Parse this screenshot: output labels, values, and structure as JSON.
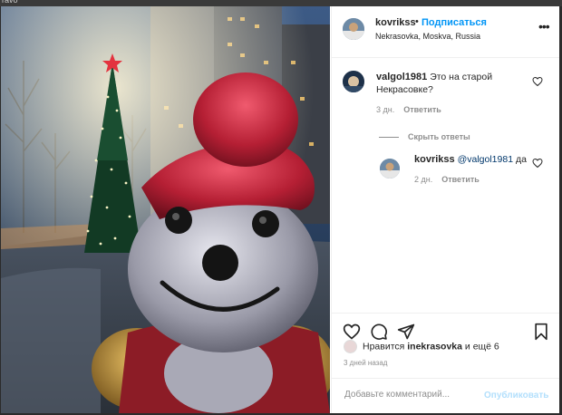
{
  "browser": {
    "crumb": "ravo"
  },
  "post": {
    "author": "kovrikss",
    "separator": "•",
    "follow_label": "Подписаться",
    "location": "Nekrasovka, Moskva, Russia",
    "more_icon": "more-horizontal-icon"
  },
  "comments": [
    {
      "username": "valgol1981",
      "text": "Это на старой Некрасовке?",
      "time": "3 дн.",
      "reply_label": "Ответить"
    }
  ],
  "hide_replies_label": "Скрыть ответы",
  "replies": [
    {
      "username": "kovrikss",
      "mention": "@valgol1981",
      "text": "да",
      "time": "2 дн.",
      "reply_label": "Ответить"
    }
  ],
  "actions": {
    "like_icon": "heart-icon",
    "comment_icon": "comment-icon",
    "share_icon": "share-icon",
    "save_icon": "bookmark-icon"
  },
  "likes": {
    "prefix": "Нравится",
    "user": "inekrasovka",
    "suffix": "и ещё 6"
  },
  "date": "3 дней назад",
  "composer": {
    "placeholder": "Добавьте комментарий...",
    "post_label": "Опубликовать"
  },
  "colors": {
    "accent": "#0095f6",
    "post_disabled": "#b2dffc",
    "muted": "#8e8e8e"
  }
}
